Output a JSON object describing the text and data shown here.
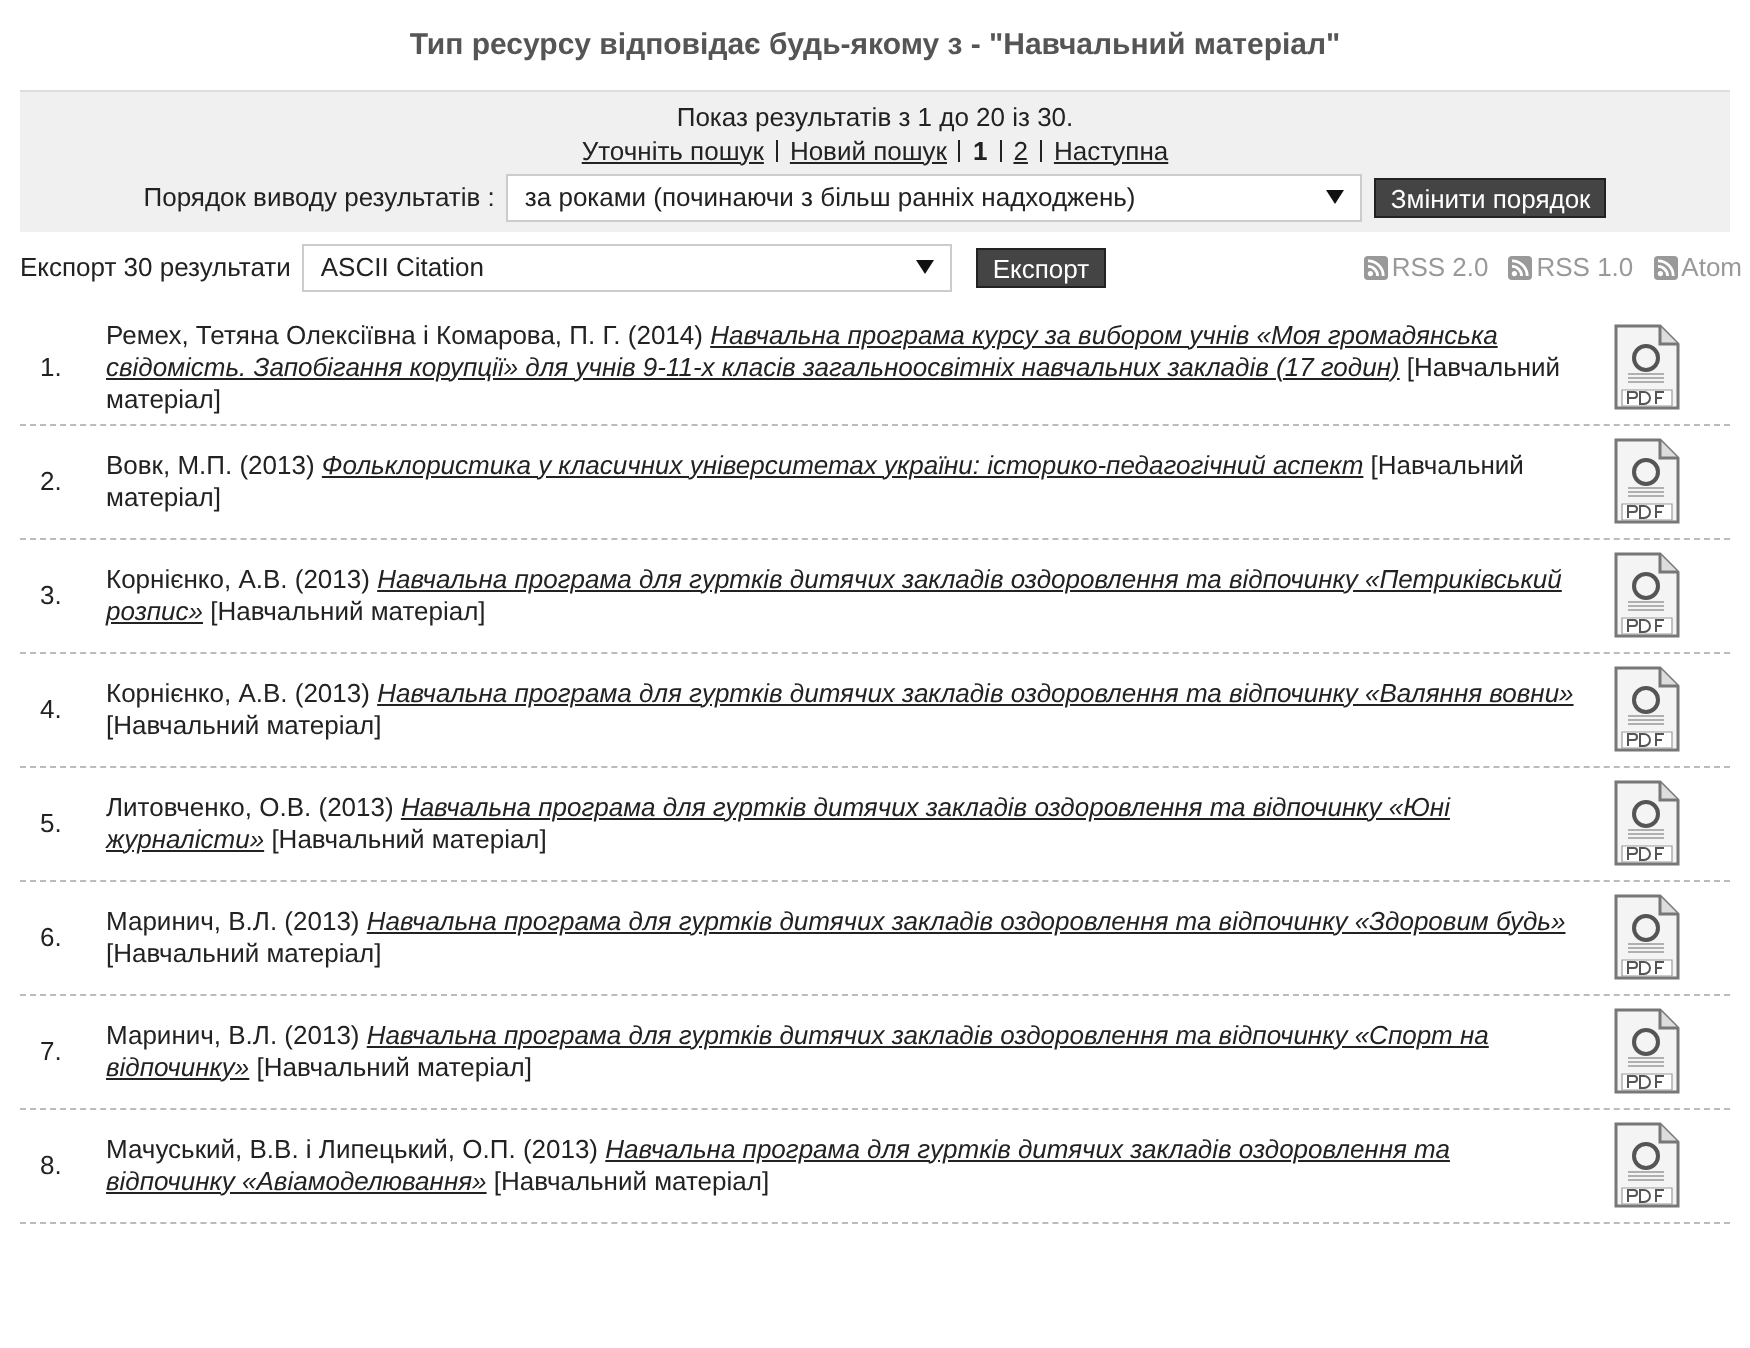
{
  "heading": "Тип ресурсу відповідає будь-якому з - \"Навчальний матеріал\"",
  "summary": "Показ результатів з 1 до 20 із 30.",
  "nav": [
    {
      "kind": "link",
      "label": "Уточніть пошук"
    },
    {
      "kind": "link",
      "label": "Новий пошук"
    },
    {
      "kind": "page",
      "label": "1",
      "selected": true
    },
    {
      "kind": "page",
      "label": "2",
      "selected": false
    },
    {
      "kind": "link",
      "label": "Наступна"
    }
  ],
  "order": {
    "label": "Порядок виводу результатів :",
    "value": "за роками (починаючи з більш ранніх надходжень)",
    "button": "Змінити порядок"
  },
  "export": {
    "label": "Експорт 30 результати",
    "value": "ASCII Citation",
    "button": "Експорт"
  },
  "feeds": [
    "RSS 2.0",
    "RSS 1.0",
    "Atom"
  ],
  "results": [
    {
      "number": "1.",
      "citation": "Ремех, Тетяна Олексіївна і Комарова, П. Г. (2014) *Навчальна програма курсу за вибором учнів «Моя громадянська свідомість. Запобігання корупції» для учнів 9-11-х класів загальноосвітніх навчальних закладів (17 годин)* [Навчальний матеріал]"
    },
    {
      "number": "2.",
      "citation": "Вовк, М.П. (2013) *Фольклористика у класичних університетах україни: історико-педагогічний аспект* [Навчальний матеріал]"
    },
    {
      "number": "3.",
      "citation": "Корнієнко, А.В. (2013) *Навчальна програма для гуртків дитячих закладів оздоровлення та відпочинку «Петриківський розпис»* [Навчальний матеріал]"
    },
    {
      "number": "4.",
      "citation": "Корнієнко, А.В. (2013) *Навчальна програма для гуртків дитячих закладів оздоровлення та відпочинку «Валяння вовни»* [Навчальний матеріал]"
    },
    {
      "number": "5.",
      "citation": "Литовченко, О.В. (2013) *Навчальна програма для гуртків дитячих закладів оздоровлення та відпочинку «Юні журналісти»* [Навчальний матеріал]"
    },
    {
      "number": "6.",
      "citation": "Маринич, В.Л. (2013) *Навчальна програма для гуртків дитячих закладів оздоровлення та відпочинку «Здоровим будь»* [Навчальний матеріал]"
    },
    {
      "number": "7.",
      "citation": "Маринич, В.Л. (2013) *Навчальна програма для гуртків дитячих закладів оздоровлення та відпочинку «Спорт на відпочинку»* [Навчальний матеріал]"
    },
    {
      "number": "8.",
      "citation": "Мачуський, В.В. і Липецький, О.П. (2013) *Навчальна програма для гуртків дитячих закладів оздоровлення та відпочинку «Авіамоделювання»* [Навчальний матеріал]"
    }
  ]
}
